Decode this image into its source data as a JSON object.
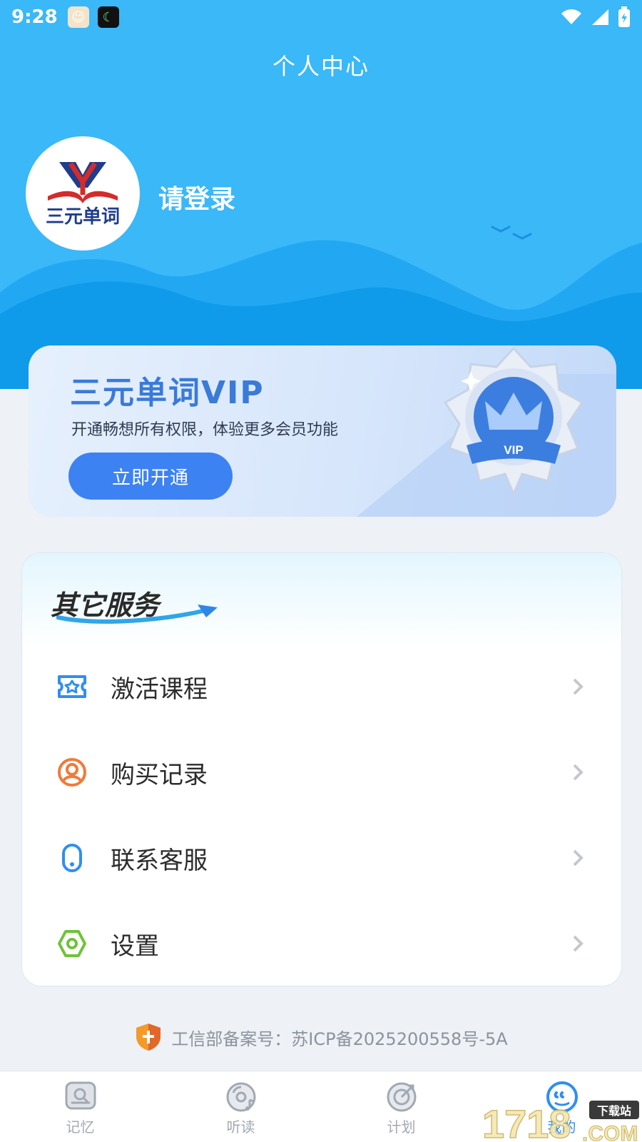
{
  "status_bar": {
    "time": "9:28"
  },
  "header": {
    "title": "个人中心"
  },
  "profile": {
    "logo_text": "三元单词",
    "login_label": "请登录"
  },
  "vip": {
    "title": "三元单词VIP",
    "subtitle": "开通畅想所有权限，体验更多会员功能",
    "button_label": "立即开通",
    "badge_text": "VIP"
  },
  "services": {
    "title": "其它服务",
    "items": [
      {
        "label": "激活课程",
        "icon": "ticket-icon",
        "color": "#2e8ff0"
      },
      {
        "label": "购买记录",
        "icon": "user-circle-icon",
        "color": "#f07a3a"
      },
      {
        "label": "联系客服",
        "icon": "phone-icon",
        "color": "#2e8ff0"
      },
      {
        "label": "设置",
        "icon": "hexagon-settings-icon",
        "color": "#6fc23a"
      }
    ]
  },
  "footer": {
    "icp": "工信部备案号：苏ICP备2025200558号-5A"
  },
  "tabs": [
    {
      "label": "记忆",
      "icon": "memory-icon",
      "active": false
    },
    {
      "label": "听读",
      "icon": "disc-icon",
      "active": false
    },
    {
      "label": "计划",
      "icon": "target-icon",
      "active": false
    },
    {
      "label": "我的",
      "icon": "quote-profile-icon",
      "active": true
    }
  ],
  "watermark": {
    "text": "1718",
    "sub": "下载站",
    "suffix": ".COM"
  },
  "colors": {
    "brand_blue": "#3ab8f8",
    "accent": "#3d82f2",
    "wave_dark": "#0f9bea"
  }
}
